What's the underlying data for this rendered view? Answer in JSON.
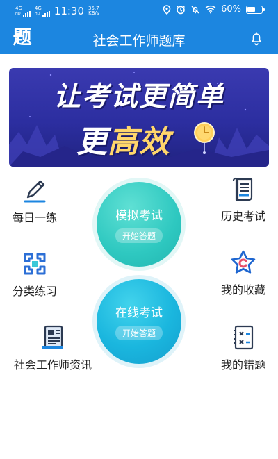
{
  "status_bar": {
    "network_1": "4G",
    "network_1_sup": "HD",
    "network_2": "4G",
    "network_2_sup": "HD",
    "time": "11:30",
    "speed_value": "35.7",
    "speed_unit": "KB/s",
    "battery_percent": "60%",
    "battery_level": 0.6
  },
  "header": {
    "logo_text": "题",
    "title": "社会工作师题库"
  },
  "banner": {
    "line1": "让考试更简单",
    "line2_part1": "更",
    "line2_part2": "高效"
  },
  "menu": {
    "daily_practice": "每日一练",
    "history_exam": "历史考试",
    "category_practice": "分类练习",
    "my_favorites": "我的收藏",
    "news": "社会工作师资讯",
    "my_mistakes": "我的错题"
  },
  "center_buttons": {
    "mock_exam_title": "模拟考试",
    "mock_exam_action": "开始答题",
    "online_exam_title": "在线考试",
    "online_exam_action": "开始答题"
  },
  "colors": {
    "primary": "#1c86e0",
    "banner_bg": "#2c2ea0",
    "accent_yellow": "#ffd66b",
    "teal": "#2ec8c0",
    "cyan": "#1ab6de"
  }
}
